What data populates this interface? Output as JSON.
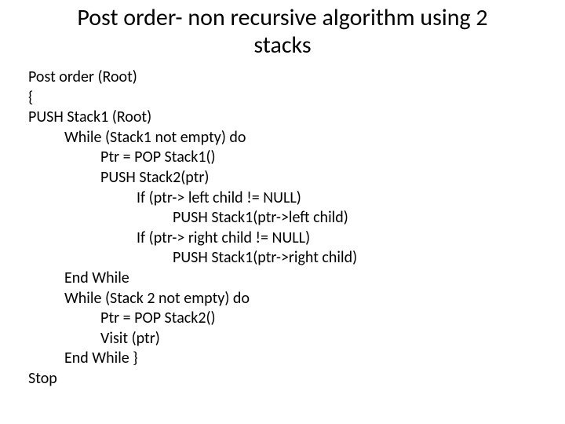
{
  "title": "Post order- non recursive algorithm using 2\nstacks",
  "code": {
    "lines": [
      {
        "indent": 0,
        "text": "Post order (Root)"
      },
      {
        "indent": 0,
        "text": "{"
      },
      {
        "indent": 0,
        "text": "PUSH Stack1 (Root)"
      },
      {
        "indent": 1,
        "text": "While (Stack1 not empty) do"
      },
      {
        "indent": 2,
        "text": "Ptr = POP Stack1()"
      },
      {
        "indent": 2,
        "text": "PUSH Stack2(ptr)"
      },
      {
        "indent": 3,
        "text": "If (ptr-> left child != NULL)"
      },
      {
        "indent": 4,
        "text": "PUSH Stack1(ptr->left child)"
      },
      {
        "indent": 3,
        "text": "If (ptr-> right child != NULL)"
      },
      {
        "indent": 4,
        "text": "PUSH Stack1(ptr->right child)"
      },
      {
        "indent": 1,
        "text": "End While"
      },
      {
        "indent": 1,
        "text": "While (Stack 2 not empty) do"
      },
      {
        "indent": 2,
        "text": "Ptr = POP Stack2()"
      },
      {
        "indent": 2,
        "text": "Visit (ptr)"
      },
      {
        "indent": 1,
        "text": "End While }"
      },
      {
        "indent": 0,
        "text": "Stop"
      }
    ]
  }
}
